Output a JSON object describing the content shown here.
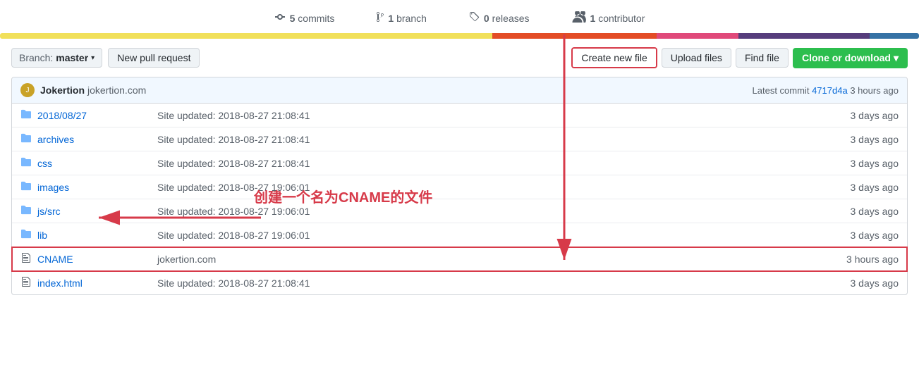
{
  "stats": {
    "commits": {
      "icon": "commit",
      "count": "5",
      "label": "commits"
    },
    "branches": {
      "icon": "branch",
      "count": "1",
      "label": "branch"
    },
    "releases": {
      "icon": "tag",
      "count": "0",
      "label": "releases"
    },
    "contributors": {
      "icon": "people",
      "count": "1",
      "label": "contributor"
    }
  },
  "toolbar": {
    "branch_label": "Branch:",
    "branch_name": "master",
    "new_pr_label": "New pull request",
    "create_new_label": "Create new file",
    "upload_label": "Upload files",
    "find_label": "Find file",
    "clone_label": "Clone or download"
  },
  "commit_header": {
    "avatar_text": "J",
    "committer_name": "Jokertion",
    "committer_link": "jokertion.com",
    "latest_label": "Latest commit",
    "commit_hash": "4717d4a",
    "commit_time": "3 hours ago"
  },
  "files": [
    {
      "type": "folder",
      "name": "2018/08/27",
      "message": "Site updated: 2018-08-27 21:08:41",
      "time": "3 days ago",
      "highlighted": false
    },
    {
      "type": "folder",
      "name": "archives",
      "message": "Site updated: 2018-08-27 21:08:41",
      "time": "3 days ago",
      "highlighted": false
    },
    {
      "type": "folder",
      "name": "css",
      "message": "Site updated: 2018-08-27 21:08:41",
      "time": "3 days ago",
      "highlighted": false
    },
    {
      "type": "folder",
      "name": "images",
      "message": "Site updated: 2018-08-27 19:06:01",
      "time": "3 days ago",
      "highlighted": false
    },
    {
      "type": "folder",
      "name": "js/src",
      "message": "Site updated: 2018-08-27 19:06:01",
      "time": "3 days ago",
      "highlighted": false
    },
    {
      "type": "folder",
      "name": "lib",
      "message": "Site updated: 2018-08-27 19:06:01",
      "time": "3 days ago",
      "highlighted": false
    },
    {
      "type": "file",
      "name": "CNAME",
      "message": "jokertion.com",
      "time": "3 hours ago",
      "highlighted": true
    },
    {
      "type": "file",
      "name": "index.html",
      "message": "Site updated: 2018-08-27 21:08:41",
      "time": "3 days ago",
      "highlighted": false
    }
  ],
  "annotation": {
    "text": "创建一个名为CNAME的文件"
  }
}
